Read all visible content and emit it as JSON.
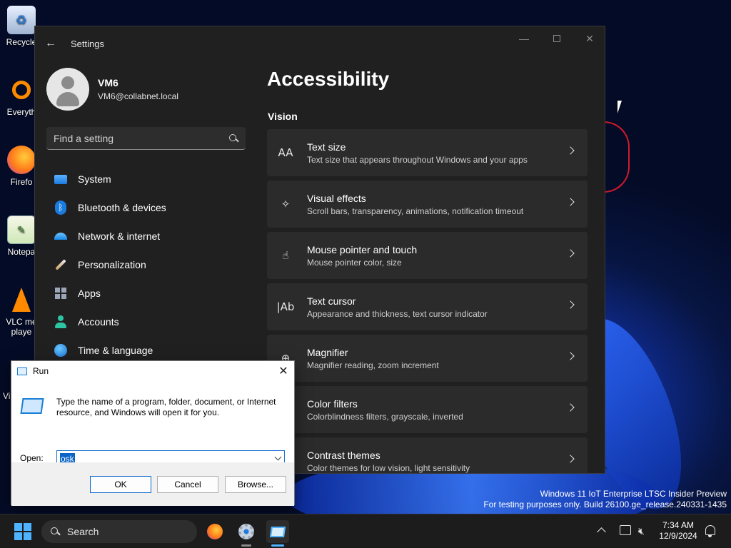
{
  "desktop": {
    "icons": [
      {
        "label": "Recycle",
        "icon": "recycle-bin-icon"
      },
      {
        "label": "Everyth",
        "icon": "everything-search-icon"
      },
      {
        "label": "Firefo",
        "icon": "firefox-icon"
      },
      {
        "label": "Notepa",
        "icon": "notepad-icon"
      },
      {
        "label": "VLC me",
        "label2": "playe",
        "icon": "vlc-icon"
      }
    ],
    "partial_label": "Vi",
    "watermark_line1": "Windows 11 IoT Enterprise LTSC Insider Preview",
    "watermark_line2": "For testing purposes only. Build 26100.ge_release.240331-1435"
  },
  "settings": {
    "window_title": "Settings",
    "profile": {
      "name": "VM6",
      "email": "VM6@collabnet.local"
    },
    "search_placeholder": "Find a setting",
    "nav": [
      {
        "label": "System",
        "icon": "system-icon"
      },
      {
        "label": "Bluetooth & devices",
        "icon": "bluetooth-icon"
      },
      {
        "label": "Network & internet",
        "icon": "wifi-icon"
      },
      {
        "label": "Personalization",
        "icon": "brush-icon"
      },
      {
        "label": "Apps",
        "icon": "apps-icon"
      },
      {
        "label": "Accounts",
        "icon": "account-icon"
      },
      {
        "label": "Time & language",
        "icon": "globe-clock-icon"
      }
    ],
    "page_title": "Accessibility",
    "section_title": "Vision",
    "cards": [
      {
        "title": "Text size",
        "desc": "Text size that appears throughout Windows and your apps",
        "icon": "text-size-icon",
        "glyph": "AA"
      },
      {
        "title": "Visual effects",
        "desc": "Scroll bars, transparency, animations, notification timeout",
        "icon": "visual-effects-icon",
        "glyph": "✧"
      },
      {
        "title": "Mouse pointer and touch",
        "desc": "Mouse pointer color, size",
        "icon": "mouse-pointer-icon",
        "glyph": "☝"
      },
      {
        "title": "Text cursor",
        "desc": "Appearance and thickness, text cursor indicator",
        "icon": "text-cursor-icon",
        "glyph": "|Ab"
      },
      {
        "title": "Magnifier",
        "desc": "Magnifier reading, zoom increment",
        "icon": "magnifier-icon",
        "glyph": "⊕"
      },
      {
        "title": "Color filters",
        "desc": "Colorblindness filters, grayscale, inverted",
        "icon": "color-filters-icon",
        "glyph": "◐"
      },
      {
        "title": "Contrast themes",
        "desc": "Color themes for low vision, light sensitivity",
        "icon": "contrast-icon",
        "glyph": "◑"
      }
    ]
  },
  "run_dialog": {
    "title": "Run",
    "message": "Type the name of a program, folder, document, or Internet resource, and Windows will open it for you.",
    "open_label": "Open:",
    "open_value": "osk",
    "ok_label": "OK",
    "cancel_label": "Cancel",
    "browse_label": "Browse..."
  },
  "taskbar": {
    "search_label": "Search",
    "time": "7:34 AM",
    "date": "12/9/2024"
  }
}
